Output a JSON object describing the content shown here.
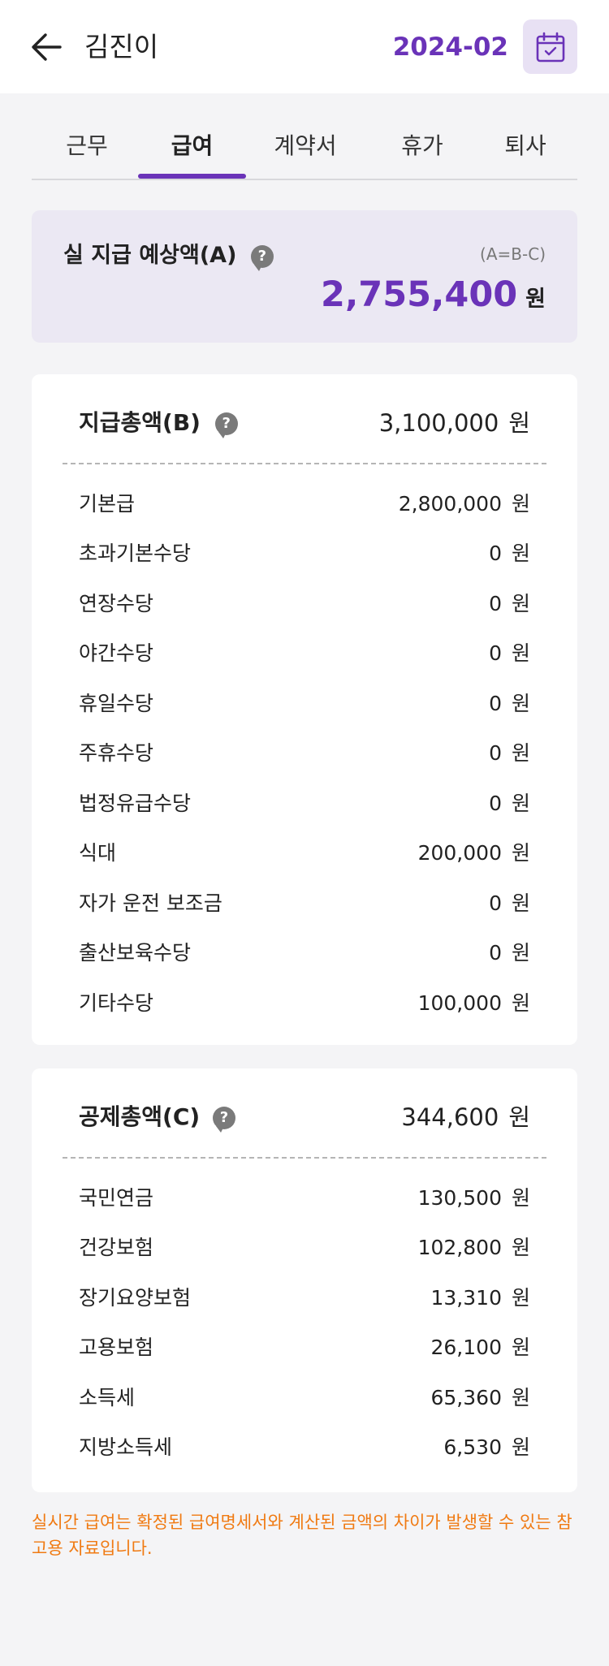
{
  "header": {
    "name": "김진이",
    "month": "2024-02",
    "back_icon": "arrow-left-icon",
    "calendar_icon": "calendar-check-icon"
  },
  "tabs": [
    {
      "label": "근무",
      "active": false
    },
    {
      "label": "급여",
      "active": true
    },
    {
      "label": "계약서",
      "active": false
    },
    {
      "label": "휴가",
      "active": false
    },
    {
      "label": "퇴사",
      "active": false
    }
  ],
  "summary": {
    "label": "실 지급 예상액(A)",
    "formula": "(A=B-C)",
    "amount": "2,755,400",
    "unit": "원"
  },
  "payments": {
    "title": "지급총액(B)",
    "total": "3,100,000",
    "unit": "원",
    "items": [
      {
        "label": "기본급",
        "value": "2,800,000"
      },
      {
        "label": "초과기본수당",
        "value": "0"
      },
      {
        "label": "연장수당",
        "value": "0"
      },
      {
        "label": "야간수당",
        "value": "0"
      },
      {
        "label": "휴일수당",
        "value": "0"
      },
      {
        "label": "주휴수당",
        "value": "0"
      },
      {
        "label": "법정유급수당",
        "value": "0"
      },
      {
        "label": "식대",
        "value": "200,000"
      },
      {
        "label": "자가 운전 보조금",
        "value": "0"
      },
      {
        "label": "출산보육수당",
        "value": "0"
      },
      {
        "label": "기타수당",
        "value": "100,000"
      }
    ]
  },
  "deductions": {
    "title": "공제총액(C)",
    "total": "344,600",
    "unit": "원",
    "items": [
      {
        "label": "국민연금",
        "value": "130,500"
      },
      {
        "label": "건강보험",
        "value": "102,800"
      },
      {
        "label": "장기요양보험",
        "value": "13,310"
      },
      {
        "label": "고용보험",
        "value": "26,100"
      },
      {
        "label": "소득세",
        "value": "65,360"
      },
      {
        "label": "지방소득세",
        "value": "6,530"
      }
    ]
  },
  "help_mark": "?",
  "notice": "실시간 급여는 확정된 급여명세서와 계산된 금액의 차이가 발생할 수 있는 참고용 자료입니다.",
  "colors": {
    "accent": "#6a33b8",
    "notice": "#f07a12",
    "summary_bg": "#ebe8f3",
    "page_bg": "#f4f4f6"
  }
}
